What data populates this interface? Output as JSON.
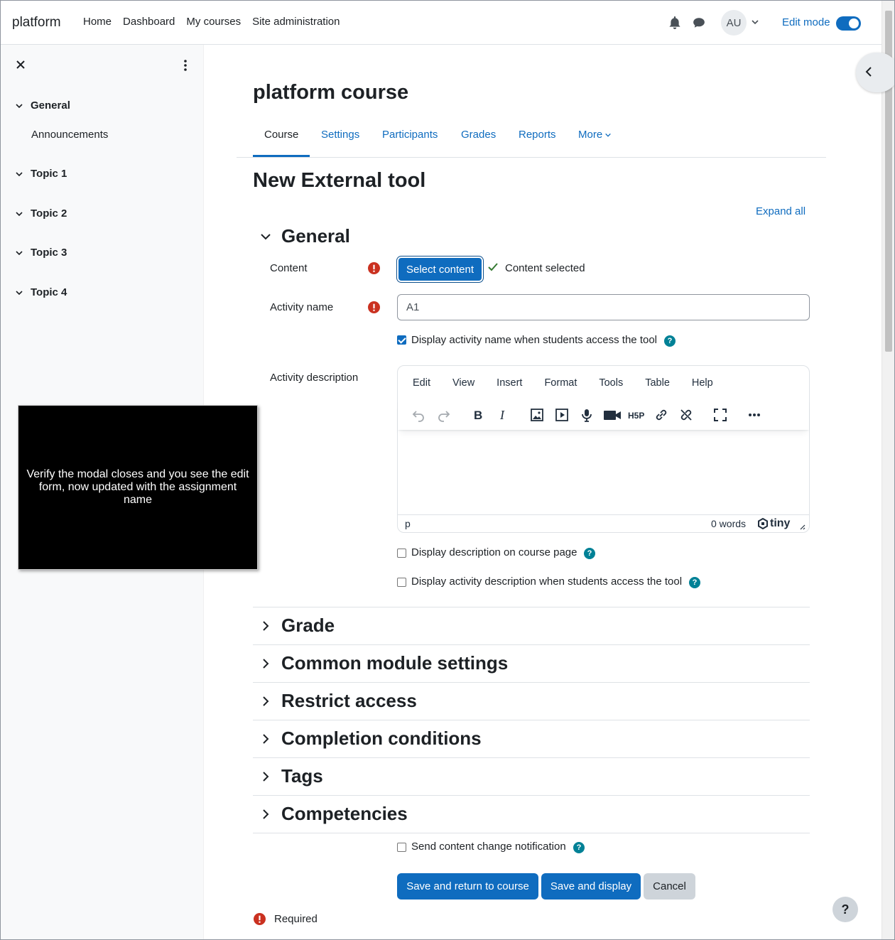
{
  "navbar": {
    "brand": "platform",
    "links": [
      "Home",
      "Dashboard",
      "My courses",
      "Site administration"
    ],
    "avatar_initials": "AU",
    "edit_mode_label": "Edit mode",
    "edit_mode_on": true
  },
  "drawer": {
    "sections": [
      {
        "label": "General",
        "items": [
          "Announcements"
        ]
      },
      {
        "label": "Topic 1",
        "items": []
      },
      {
        "label": "Topic 2",
        "items": []
      },
      {
        "label": "Topic 3",
        "items": []
      },
      {
        "label": "Topic 4",
        "items": []
      }
    ]
  },
  "overlay": {
    "text": "Verify the modal closes and you see the edit form, now updated with the assignment name"
  },
  "course": {
    "title": "platform course",
    "tabs": [
      "Course",
      "Settings",
      "Participants",
      "Grades",
      "Reports",
      "More"
    ],
    "active_tab": "Course"
  },
  "form": {
    "heading": "New External tool",
    "expand_all": "Expand all",
    "general_heading": "General",
    "content_label": "Content",
    "select_content_button": "Select content",
    "content_selected": "Content selected",
    "activity_name_label": "Activity name",
    "activity_name_value": "A1",
    "display_name_checkbox": "Display activity name when students access the tool",
    "display_name_checked": true,
    "activity_description_label": "Activity description",
    "editor": {
      "menus": [
        "Edit",
        "View",
        "Insert",
        "Format",
        "Tools",
        "Table",
        "Help"
      ],
      "status_path": "p",
      "word_count": "0 words",
      "brand": "tiny"
    },
    "display_description_checkbox": "Display description on course page",
    "display_description_tool_checkbox": "Display activity description when students access the tool",
    "collapsed_sections": [
      "Grade",
      "Common module settings",
      "Restrict access",
      "Completion conditions",
      "Tags",
      "Competencies"
    ],
    "send_notification_checkbox": "Send content change notification",
    "buttons": {
      "save_return": "Save and return to course",
      "save_display": "Save and display",
      "cancel": "Cancel"
    },
    "required_note": "Required"
  },
  "help_fab": "?"
}
